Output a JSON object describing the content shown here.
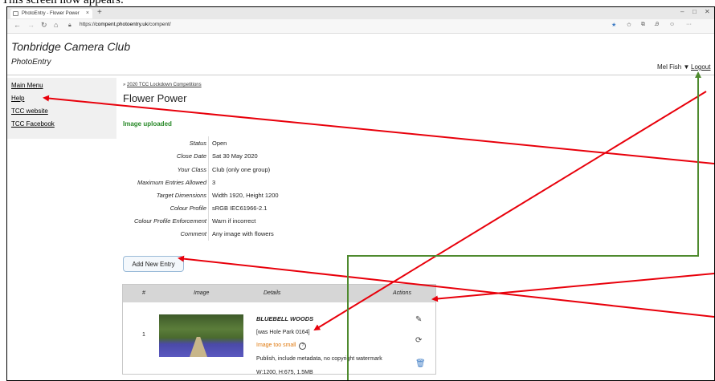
{
  "caption": "This screen now appears:",
  "browser": {
    "tab_title": "PhotoEntry - Flower Power",
    "tab_close": "×",
    "new_tab": "+",
    "url_prefix": "https://",
    "url_host": "compent.photoentry.uk",
    "url_path": "/compent/",
    "win_min": "–",
    "win_max": "□",
    "win_close": "✕"
  },
  "site": {
    "title": "Tonbridge Camera Club",
    "subtitle": "PhotoEntry",
    "user": "Mel Fish",
    "user_caret": "▼",
    "logout": "Logout"
  },
  "sidebar": {
    "items": [
      {
        "label": "Main Menu"
      },
      {
        "label": "Help"
      },
      {
        "label": "TCC website"
      },
      {
        "label": "TCC Facebook"
      }
    ]
  },
  "main": {
    "breadcrumb_prefix": "»",
    "breadcrumb": "2020 TCC Lockdown Competitions",
    "title": "Flower Power",
    "message": "Image uploaded",
    "details": [
      {
        "label": "Status",
        "value": "Open"
      },
      {
        "label": "Close Date",
        "value": "Sat 30 May 2020"
      },
      {
        "label": "Your Class",
        "value": "Club (only one group)"
      },
      {
        "label": "Maximum Entries Allowed",
        "value": "3"
      },
      {
        "label": "Target Dimensions",
        "value": "Width 1920, Height 1200"
      },
      {
        "label": "Colour Profile",
        "value": "sRGB IEC61966-2.1"
      },
      {
        "label": "Colour Profile Enforcement",
        "value": "Warn if incorrect"
      },
      {
        "label": "Comment",
        "value": "Any image with flowers"
      }
    ],
    "add_button": "Add New Entry",
    "table": {
      "headers": [
        "#",
        "Image",
        "Details",
        "Actions"
      ],
      "rows": [
        {
          "num": "1",
          "title": "BLUEBELL WOODS",
          "was": "[was Hole Park 0164]",
          "warning": "Image too small",
          "help_icon": "?",
          "publish": "Publish, include metadata, no copyright watermark",
          "size": "W:1200, H:675, 1.5MB"
        }
      ]
    }
  },
  "colors": {
    "red_arrow": "#e8000b",
    "green_arrow": "#4e8a2e",
    "success": "#2a8a2a",
    "warning": "#e07a10"
  },
  "icons": {
    "edit": "edit-icon",
    "rotate": "rotate-icon",
    "delete": "trash-icon"
  }
}
